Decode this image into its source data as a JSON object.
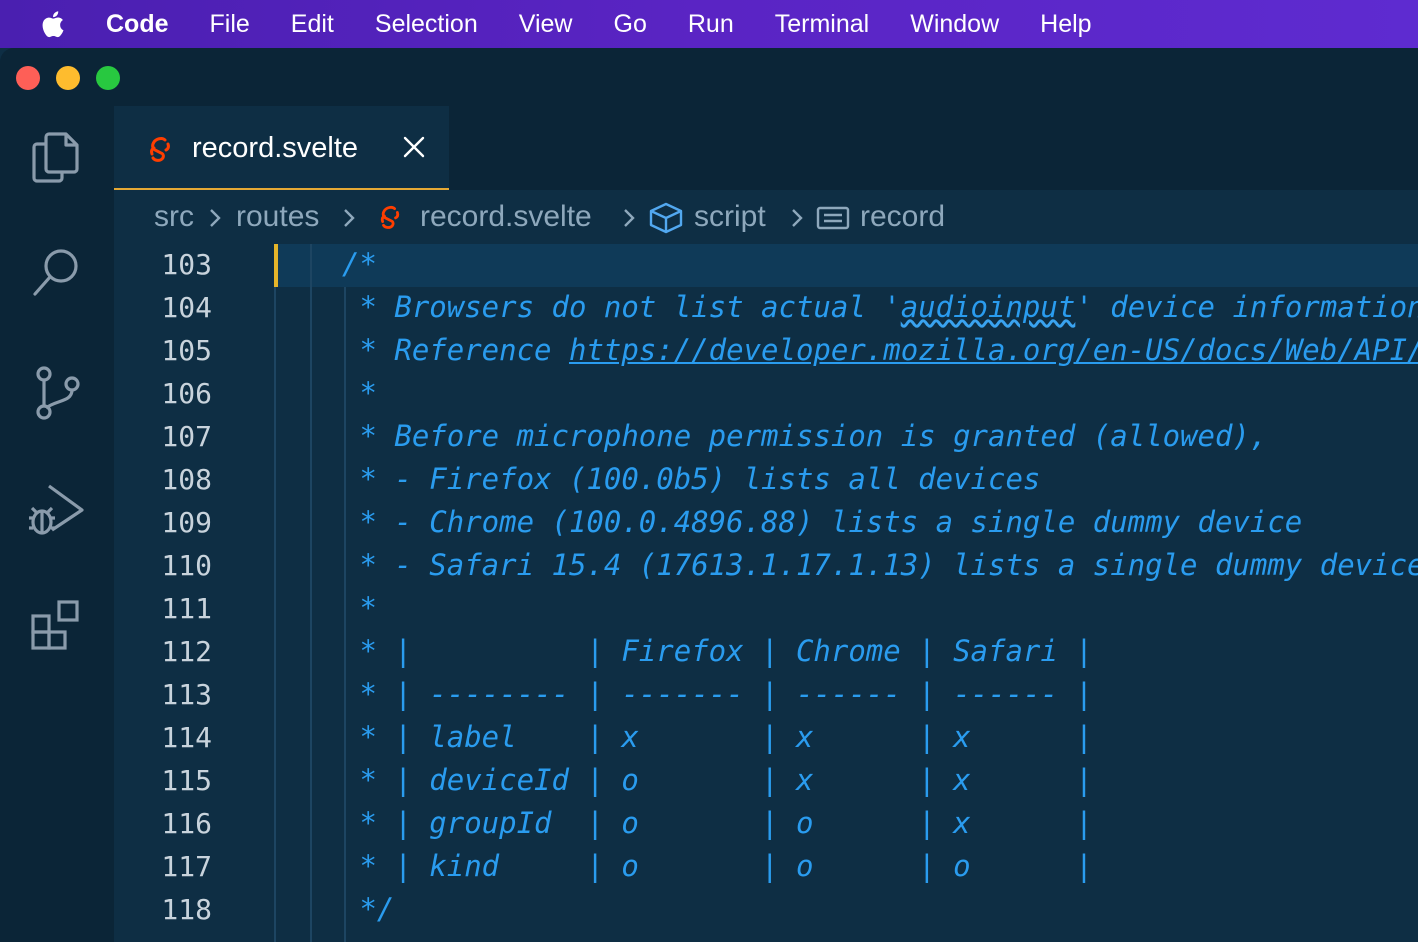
{
  "menubar": {
    "app": "Code",
    "items": [
      "File",
      "Edit",
      "Selection",
      "View",
      "Go",
      "Run",
      "Terminal",
      "Window",
      "Help"
    ]
  },
  "tab": {
    "title": "record.svelte"
  },
  "breadcrumb": {
    "folder1": "src",
    "folder2": "routes",
    "file": "record.svelte",
    "symbol1": "script",
    "symbol2": "record"
  },
  "editor": {
    "lines": [
      {
        "number": "103",
        "pre": "/*"
      },
      {
        "number": "104",
        "pre": " * Browsers do not list actual '",
        "squiggle": "audioinput",
        "post": "' device information"
      },
      {
        "number": "105",
        "pre": " * Reference ",
        "link": "https://developer.mozilla.org/en-US/docs/Web/API/"
      },
      {
        "number": "106",
        "pre": " *"
      },
      {
        "number": "107",
        "pre": " * Before microphone permission is granted (allowed),"
      },
      {
        "number": "108",
        "pre": " * - Firefox (100.0b5) lists all devices"
      },
      {
        "number": "109",
        "pre": " * - Chrome (100.0.4896.88) lists a single dummy device"
      },
      {
        "number": "110",
        "pre": " * - Safari 15.4 (17613.1.17.1.13) lists a single dummy device"
      },
      {
        "number": "111",
        "pre": " *"
      },
      {
        "number": "112",
        "pre": " * |          | Firefox | Chrome | Safari |"
      },
      {
        "number": "113",
        "pre": " * | -------- | ------- | ------ | ------ |"
      },
      {
        "number": "114",
        "pre": " * | label    | x       | x      | x      |"
      },
      {
        "number": "115",
        "pre": " * | deviceId | o       | x      | x      |"
      },
      {
        "number": "116",
        "pre": " * | groupId  | o       | o      | x      |"
      },
      {
        "number": "117",
        "pre": " * | kind     | o       | o      | o      |"
      },
      {
        "number": "118",
        "pre": " */"
      }
    ]
  },
  "icons": {
    "apple": "apple-icon",
    "explorer": "files-icon",
    "search": "search-icon",
    "scm": "source-control-icon",
    "debug": "run-debug-icon",
    "extensions": "extensions-icon",
    "svelte": "svelte-icon",
    "close": "close-icon",
    "symbol_method": "cube-icon",
    "symbol_field": "field-icon"
  },
  "colors": {
    "menubar": "#5a24c4",
    "editor_bg": "#0e2e44",
    "comment": "#2a9cef",
    "tab_border": "#e5a935",
    "svelte": "#ff3e00"
  }
}
